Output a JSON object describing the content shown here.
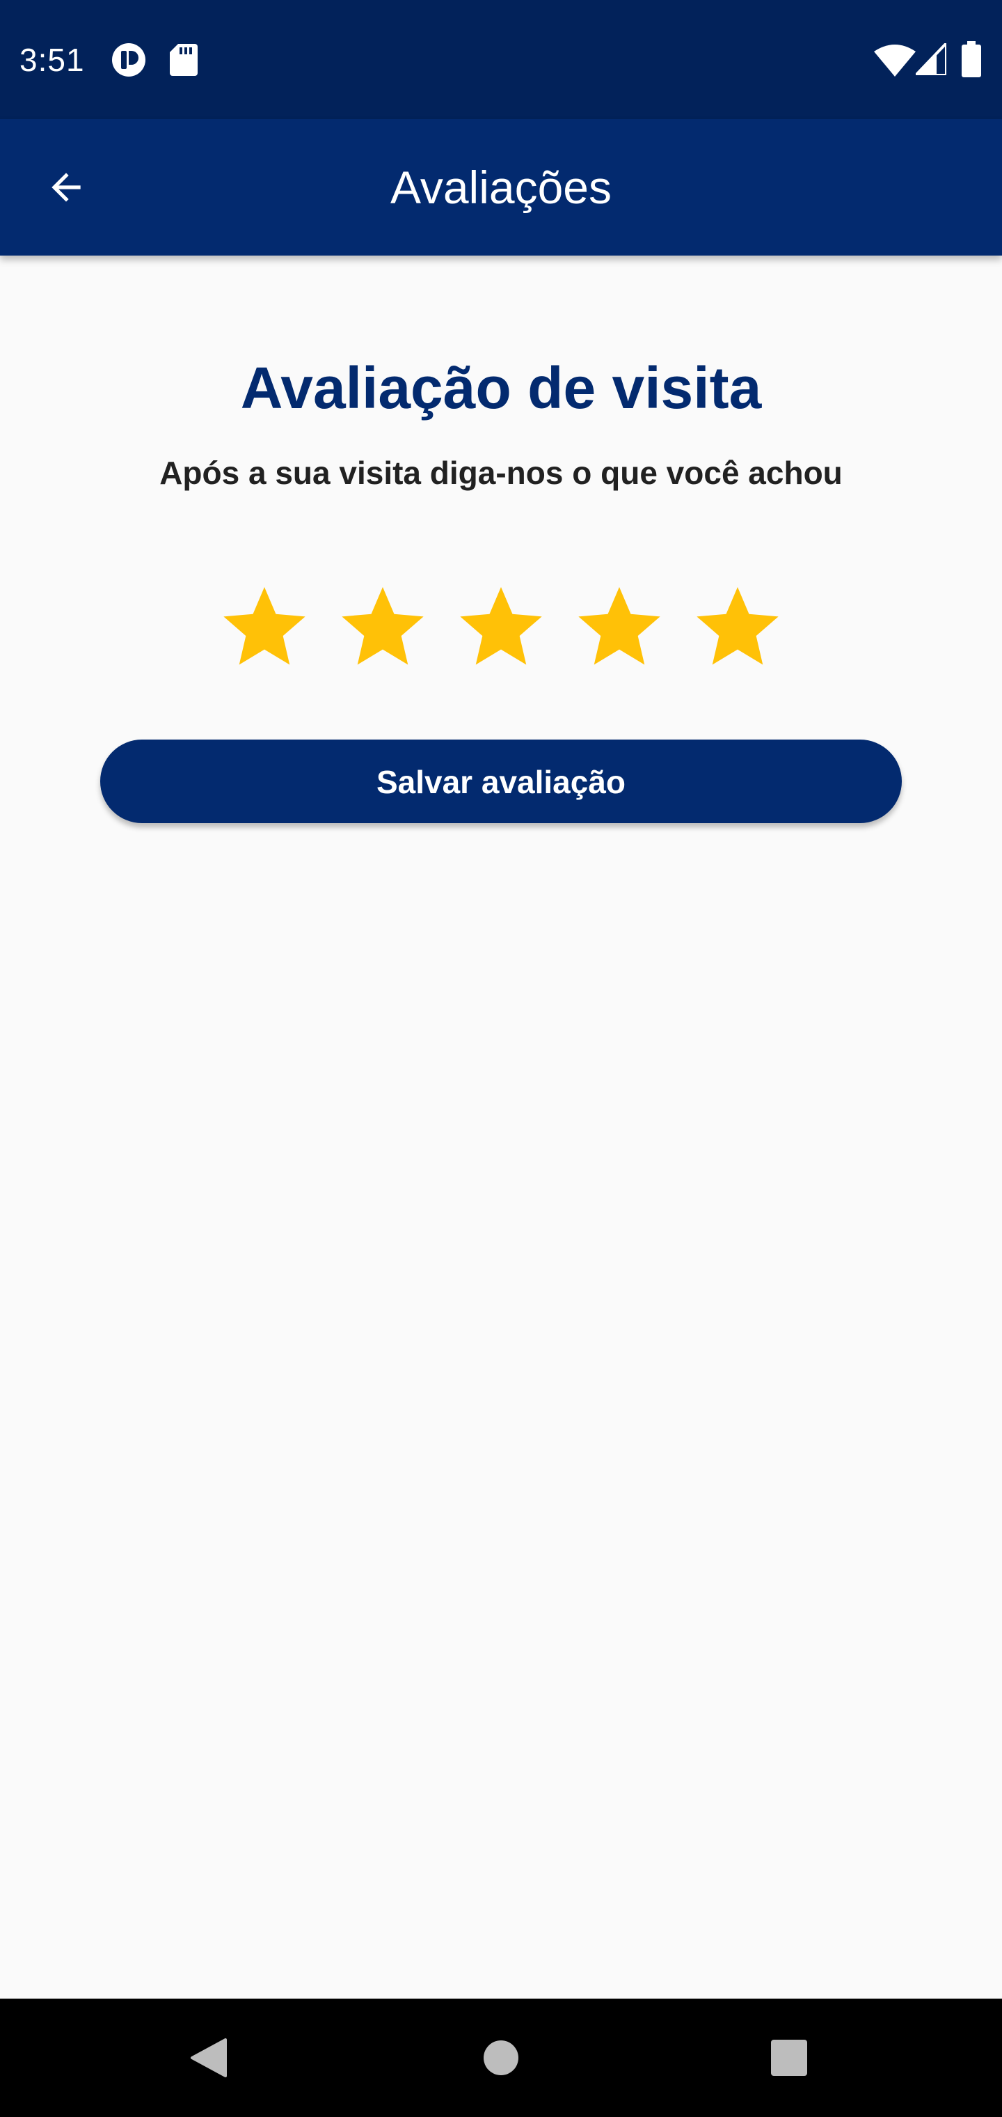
{
  "status_bar": {
    "time": "3:51",
    "left_icons": [
      "app-notification-icon",
      "sd-card-icon"
    ],
    "right_icons": [
      "wifi-icon",
      "cellular-signal-icon",
      "battery-icon"
    ]
  },
  "app_bar": {
    "back_icon": "arrow-back-icon",
    "title": "Avaliações"
  },
  "main": {
    "title": "Avaliação de visita",
    "subtitle": "Após a sua visita diga-nos o que você achou",
    "rating": {
      "value": 5,
      "max": 5,
      "star_color": "#ffc107"
    },
    "save_button_label": "Salvar avaliação"
  },
  "nav_bar": {
    "buttons": [
      "back-triangle-icon",
      "home-circle-icon",
      "recents-square-icon"
    ]
  },
  "colors": {
    "status_bar": "#02225a",
    "primary": "#032a6f",
    "background": "#fafafa",
    "text_dark": "#212121",
    "star": "#ffc107"
  }
}
